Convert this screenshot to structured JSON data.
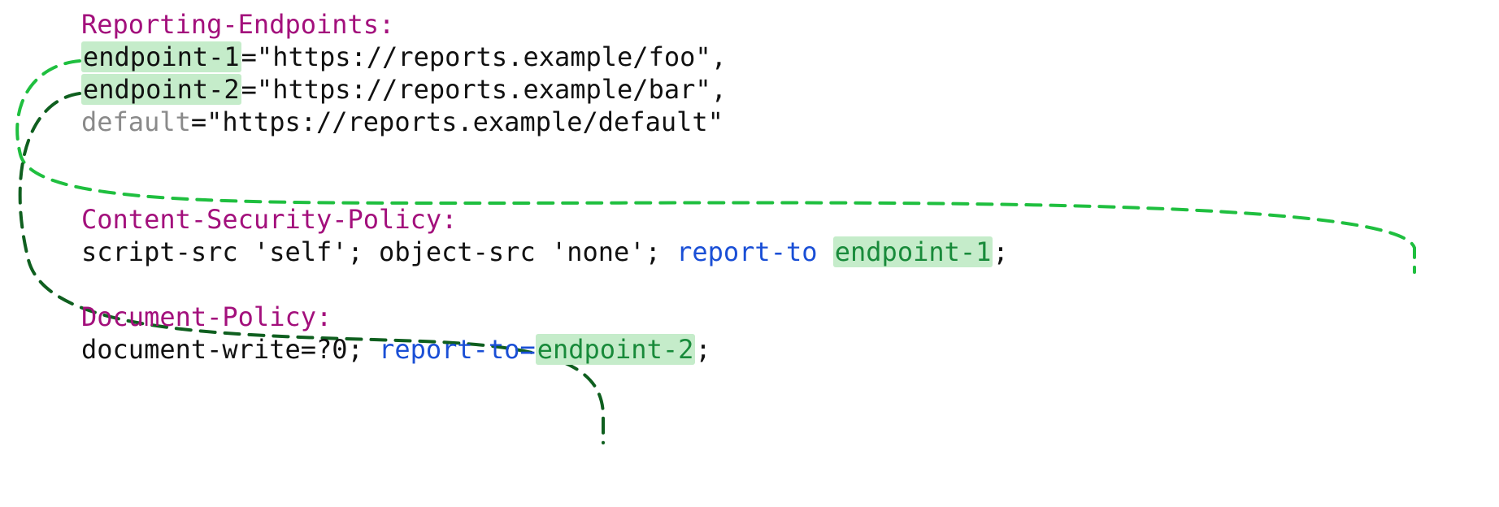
{
  "headers": {
    "reporting": {
      "name": "Reporting-Endpoints:",
      "endpoints": [
        {
          "key": "endpoint-1",
          "eq": "=",
          "url": "\"https://reports.example/foo\"",
          "tail": ","
        },
        {
          "key": "endpoint-2",
          "eq": "=",
          "url": "\"https://reports.example/bar\"",
          "tail": ","
        },
        {
          "key": "default",
          "eq": "=",
          "url": "\"https://reports.example/default\"",
          "tail": ""
        }
      ]
    },
    "csp": {
      "name": "Content-Security-Policy:",
      "body_prefix": "script-src 'self'; object-src 'none'; ",
      "directive": "report-to ",
      "endpoint": "endpoint-1",
      "tail": ";"
    },
    "docpolicy": {
      "name": "Document-Policy:",
      "body_prefix": "document-write=?0; ",
      "directive": "report-to=",
      "endpoint": "endpoint-2",
      "tail": ";"
    }
  },
  "colors": {
    "header": "#a3107c",
    "highlight_bg": "#c5ecca",
    "endpoint_text": "#188a3a",
    "directive": "#1a4fd6",
    "muted": "#8a8a8a",
    "arrow_light": "#1fbf3f",
    "arrow_dark": "#0f5f1f"
  },
  "arrows": [
    {
      "from": "endpoint-1 (Reporting-Endpoints)",
      "to": "endpoint-1 (Content-Security-Policy report-to)"
    },
    {
      "from": "endpoint-2 (Reporting-Endpoints)",
      "to": "endpoint-2 (Document-Policy report-to)"
    }
  ]
}
